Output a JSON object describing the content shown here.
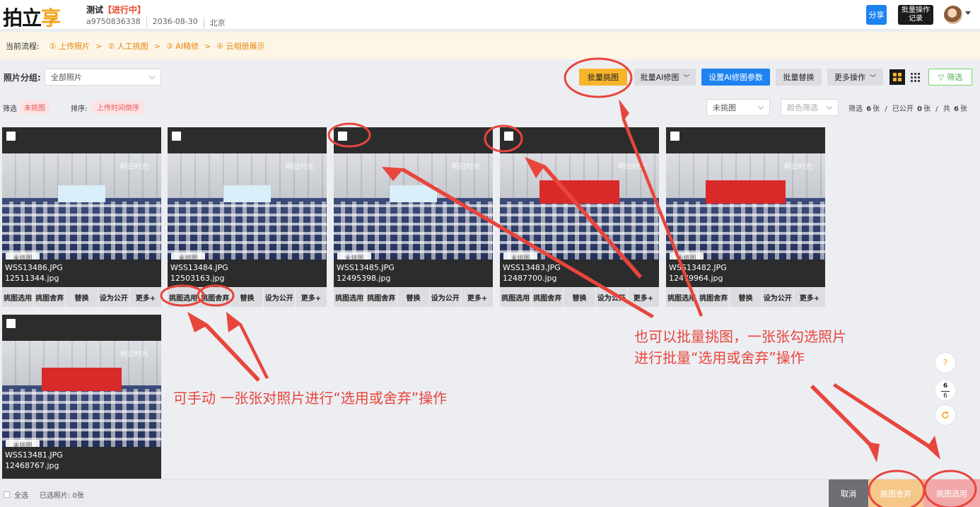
{
  "header": {
    "logo_main": "拍立",
    "logo_accent": "享",
    "project_name": "测试",
    "project_status": "【进行中】",
    "project_id": "a9750836338",
    "project_date": "2036-08-30",
    "project_city": "北京",
    "share_label": "分享",
    "batch_log_line1": "批量操作",
    "batch_log_line2": "记录"
  },
  "flow": {
    "label": "当前流程:",
    "steps": [
      "① 上传照片",
      "② 人工挑图",
      "③ AI精修",
      "④ 云相册展示"
    ],
    "separator": ">"
  },
  "toolbar": {
    "group_label": "照片分组:",
    "group_select": "全部照片",
    "batch_pick": "批量挑图",
    "batch_ai": "批量AI修图",
    "ai_params": "设置AI修图参数",
    "batch_replace": "批量替换",
    "more_ops": "更多操作",
    "filter": "筛选"
  },
  "filterrow": {
    "filter_label": "筛选",
    "filter_tag": "未挑图",
    "sort_label": "排序:",
    "sort_tag": "上传时间倒序",
    "pick_select": "未挑图",
    "color_select": "颜色筛选",
    "count_prefix": "筛选",
    "count_filtered": "6",
    "unit": "张",
    "public_prefix": "已公开",
    "count_public": "0",
    "total_prefix": "共",
    "count_total": "6",
    "divider": "/"
  },
  "photo_badges": [
    "未挑图",
    "AI未修图",
    "未公开"
  ],
  "photo_actions": [
    "挑图选用",
    "挑图舍弃",
    "替换",
    "设为公开",
    "更多+"
  ],
  "photos": [
    {
      "name": "WSS13486.JPG",
      "id": "12511344.jpg"
    },
    {
      "name": "WSS13484.JPG",
      "id": "12503163.jpg"
    },
    {
      "name": "WSS13485.JPG",
      "id": "12495398.jpg"
    },
    {
      "name": "WSS13483.JPG",
      "id": "12487700.jpg"
    },
    {
      "name": "WSS13482.JPG",
      "id": "12479964.jpg"
    },
    {
      "name": "WSS13481.JPG",
      "id": "12468767.jpg"
    }
  ],
  "watermark": "明日时光",
  "side": {
    "help": "?",
    "page_current": "6",
    "page_total": "6"
  },
  "bottombar": {
    "select_all": "全选",
    "selected_label": "已选照片: 0张",
    "cancel": "取消",
    "discard": "挑图舍弃",
    "select": "挑图选用"
  },
  "annotations": {
    "manual_note": "可手动 一张张对照片进行“选用或舍弃”操作",
    "batch_note_line1": "也可以批量挑图，一张张勾选照片",
    "batch_note_line2": "进行批量“选用或舍弃”操作"
  },
  "colors": {
    "accent_yellow": "#f7b52c",
    "primary_blue": "#1e83f0",
    "annotation_red": "#e8453c"
  }
}
